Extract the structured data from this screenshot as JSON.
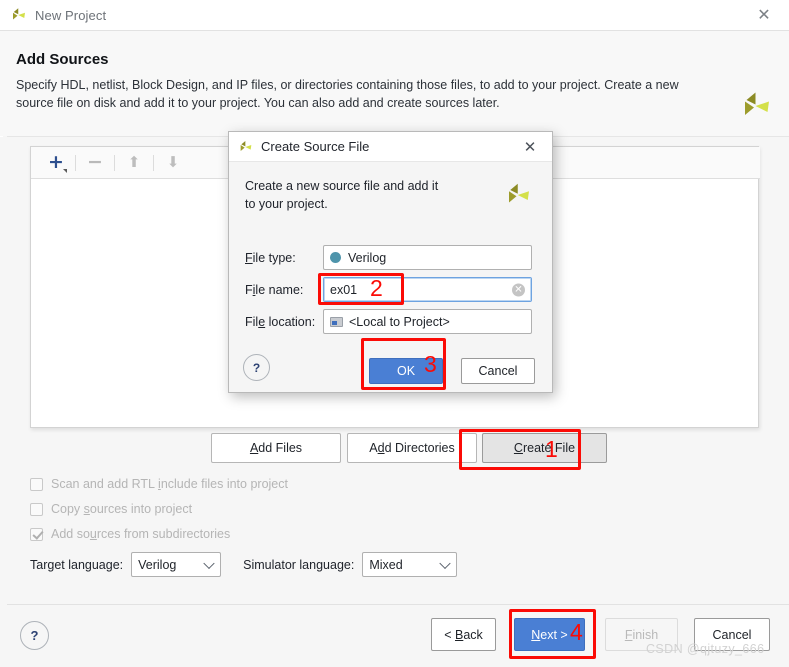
{
  "window": {
    "title": "New Project",
    "icon": "vivado-logo-icon",
    "close_label": "✕"
  },
  "page": {
    "title": "Add Sources",
    "description": "Specify HDL, netlist, Block Design, and IP files, or directories containing those files, to add to your project. Create a new source file on disk and add it to your project. You can also add and create sources later."
  },
  "toolbar": {
    "add_label": "+",
    "remove_label": "−",
    "move_up_label": "⬆",
    "move_down_label": "⬇"
  },
  "actions": {
    "add_files": {
      "prefix": "",
      "mnemonic": "A",
      "rest": "dd Files"
    },
    "add_directories": {
      "prefix": "A",
      "mnemonic": "d",
      "rest": "d Directories"
    },
    "create_file": {
      "prefix": "",
      "mnemonic": "C",
      "rest": "reate File"
    }
  },
  "options": [
    {
      "label_prefix": "Scan and add RTL ",
      "mnemonic": "i",
      "label_rest": "nclude files into project",
      "checked": false,
      "enabled": false
    },
    {
      "label_prefix": "Copy ",
      "mnemonic": "s",
      "label_rest": "ources into project",
      "checked": false,
      "enabled": false
    },
    {
      "label_prefix": "Add so",
      "mnemonic": "u",
      "label_rest": "rces from subdirectories",
      "checked": true,
      "enabled": false
    }
  ],
  "languages": {
    "target_label": "Target language:",
    "target_value": "Verilog",
    "simulator_label": "Simulator language:",
    "simulator_value": "Mixed"
  },
  "footer": {
    "help_label": "?",
    "back": {
      "prefix": "< ",
      "mnemonic": "B",
      "rest": "ack"
    },
    "next": {
      "prefix": "",
      "mnemonic": "N",
      "rest": "ext >"
    },
    "finish": {
      "prefix": "",
      "mnemonic": "F",
      "rest": "inish"
    },
    "cancel": {
      "prefix": "",
      "mnemonic": "",
      "rest": "Cancel"
    }
  },
  "watermark": "CSDN @qjtuzy_666",
  "dialog": {
    "title": "Create Source File",
    "icon": "vivado-logo-icon",
    "close_label": "✕",
    "description": "Create a new source file and add it to your project.",
    "fields": {
      "file_type": {
        "label_prefix": "",
        "mnemonic": "F",
        "label_rest": "ile type:",
        "value": "Verilog",
        "indicator_color": "#4e94ab"
      },
      "file_name": {
        "label_prefix": "F",
        "mnemonic": "i",
        "label_rest": "le name:",
        "value": "ex01",
        "placeholder": "",
        "clear_label": "✕"
      },
      "file_location": {
        "label_prefix": "Fil",
        "mnemonic": "e",
        "label_rest": " location:",
        "value": "<Local to Project>"
      }
    },
    "help_label": "?",
    "ok_label": "OK",
    "cancel_label": "Cancel"
  },
  "annotations": [
    {
      "number": "1",
      "target": "create-file-button"
    },
    {
      "number": "2",
      "target": "file-name-input"
    },
    {
      "number": "3",
      "target": "dialog-ok-button"
    },
    {
      "number": "4",
      "target": "next-button"
    }
  ],
  "colors": {
    "accent_blue": "#4a7fd4",
    "annotation_red": "#fb0b06",
    "logo_olive": "#8c8b25",
    "logo_yellow": "#d4e04a"
  }
}
